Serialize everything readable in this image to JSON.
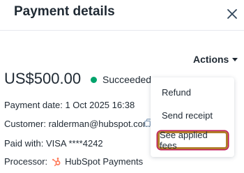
{
  "header": {
    "title": "Payment details",
    "close_icon": "close-icon"
  },
  "actions": {
    "label": "Actions",
    "icon": "chevron-down-icon",
    "menu": {
      "items": [
        {
          "label": "Refund"
        },
        {
          "label": "Send receipt"
        },
        {
          "label": "See applied fees",
          "highlighted": true
        }
      ]
    }
  },
  "payment": {
    "amount": "US$500.00",
    "status": "Succeeded",
    "status_color": "#00a36b",
    "date": "Payment date: 1 Oct 2025 16:38",
    "customer": "Customer: ralderman@hubspot.com",
    "paid_with": "Paid with: VISA ****4242",
    "processor_label": "Processor:",
    "processor_name": "HubSpot Payments",
    "processor_icon": "hubspot-icon"
  },
  "colors": {
    "highlight_border": "#b07d2a",
    "highlight_outline": "#c2185b"
  }
}
